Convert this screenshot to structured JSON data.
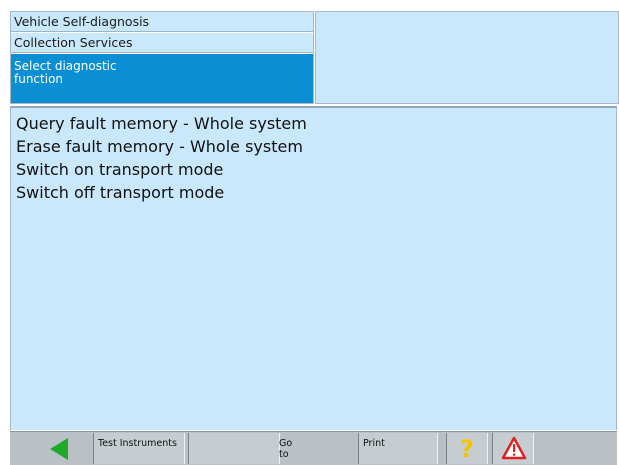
{
  "breadcrumbs": [
    "Vehicle Self-diagnosis",
    "Collection Services",
    "Select diagnostic function"
  ],
  "functions": [
    "Query fault memory - Whole system",
    "Erase fault memory - Whole system",
    "Switch on transport mode",
    "Switch off transport mode"
  ],
  "toolbar": {
    "test_instruments": "Test Instruments",
    "goto": "Go to",
    "print": "Print"
  },
  "icons": {
    "back": "back-arrow-icon",
    "help": "help-icon",
    "warning": "warning-icon"
  },
  "colors": {
    "panel_bg": "#c9e8fb",
    "selected": "#0a8fd4",
    "back_arrow": "#1faa2a",
    "help": "#f5c400",
    "warning": "#e02020"
  }
}
